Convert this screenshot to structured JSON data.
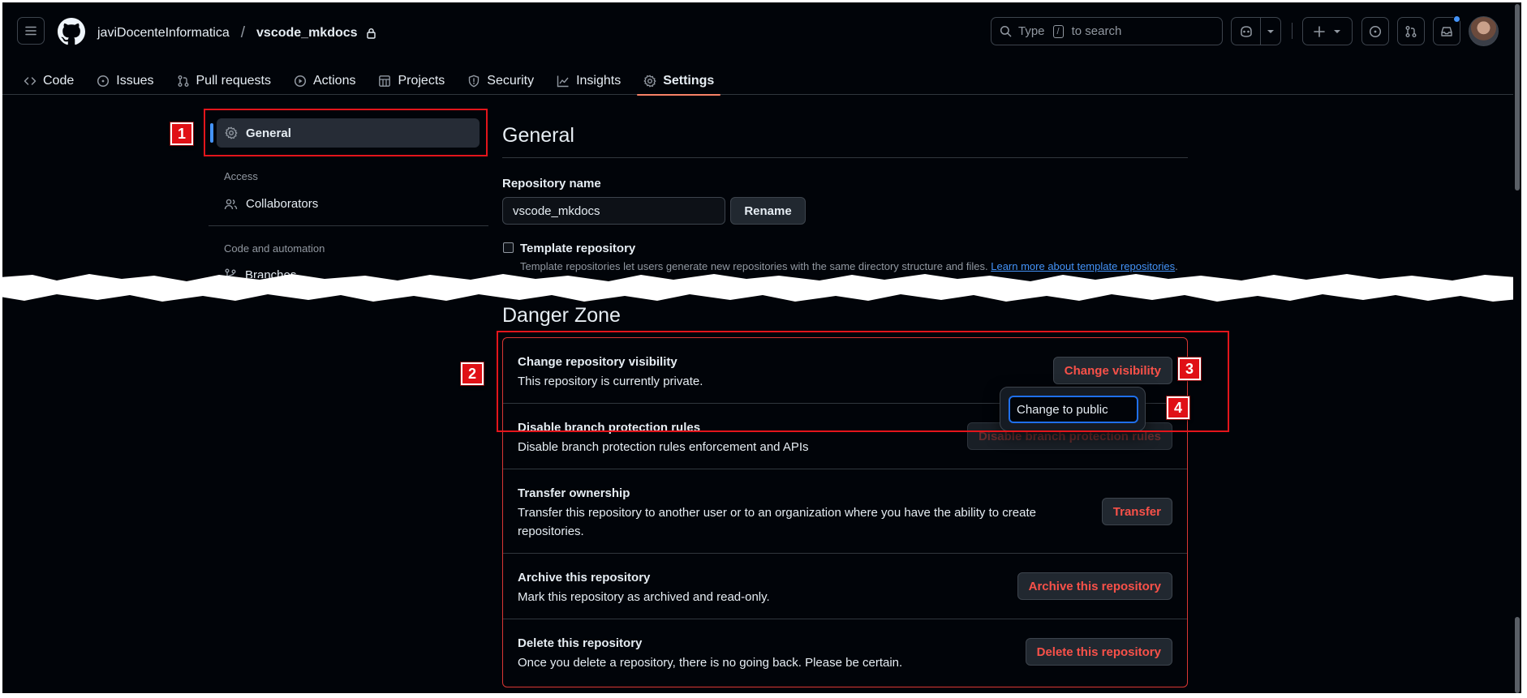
{
  "header": {
    "owner": "javiDocenteInformatica",
    "separator": "/",
    "repo": "vscode_mkdocs",
    "search": {
      "prefix": "Type",
      "key": "/",
      "suffix": "to search"
    }
  },
  "tabs": [
    {
      "label": "Code",
      "icon": "code-icon"
    },
    {
      "label": "Issues",
      "icon": "issue-icon"
    },
    {
      "label": "Pull requests",
      "icon": "pull-request-icon"
    },
    {
      "label": "Actions",
      "icon": "play-icon"
    },
    {
      "label": "Projects",
      "icon": "table-icon"
    },
    {
      "label": "Security",
      "icon": "shield-icon"
    },
    {
      "label": "Insights",
      "icon": "graph-icon"
    },
    {
      "label": "Settings",
      "icon": "gear-icon",
      "active": true
    }
  ],
  "sidebar": {
    "general": "General",
    "access_heading": "Access",
    "collaborators": "Collaborators",
    "code_heading": "Code and automation",
    "branches": "Branches"
  },
  "general": {
    "title": "General",
    "repo_name_label": "Repository name",
    "repo_name_value": "vscode_mkdocs",
    "rename_label": "Rename",
    "template_label": "Template repository",
    "template_desc": "Template repositories let users generate new repositories with the same directory structure and files.",
    "template_link": "Learn more about template repositories",
    "template_period": "."
  },
  "danger": {
    "title": "Danger Zone",
    "rows": [
      {
        "title": "Change repository visibility",
        "desc": "This repository is currently private.",
        "button": "Change visibility"
      },
      {
        "title": "Disable branch protection rules",
        "desc": "Disable branch protection rules enforcement and APIs",
        "button": "Disable branch protection rules"
      },
      {
        "title": "Transfer ownership",
        "desc": "Transfer this repository to another user or to an organization where you have the ability to create repositories.",
        "button": "Transfer"
      },
      {
        "title": "Archive this repository",
        "desc": "Mark this repository as archived and read-only.",
        "button": "Archive this repository"
      },
      {
        "title": "Delete this repository",
        "desc": "Once you delete a repository, there is no going back. Please be certain.",
        "button": "Delete this repository"
      }
    ],
    "menu_item": "Change to public"
  },
  "annotations": [
    "1",
    "2",
    "3",
    "4"
  ],
  "colors": {
    "accent": "#4493f8",
    "danger": "#f85149",
    "danger_border": "#da3633",
    "tab_underline": "#f78166",
    "annotation": "#e01016"
  }
}
